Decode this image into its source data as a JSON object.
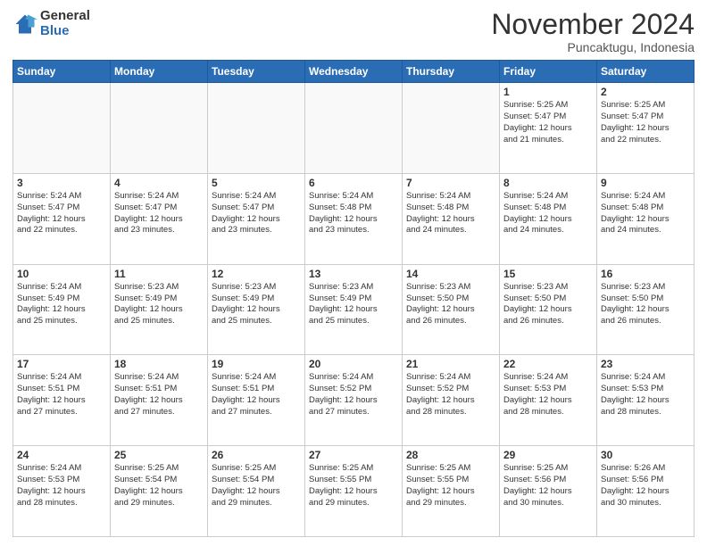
{
  "header": {
    "logo_general": "General",
    "logo_blue": "Blue",
    "month_title": "November 2024",
    "location": "Puncaktugu, Indonesia"
  },
  "weekdays": [
    "Sunday",
    "Monday",
    "Tuesday",
    "Wednesday",
    "Thursday",
    "Friday",
    "Saturday"
  ],
  "weeks": [
    [
      {
        "day": "",
        "info": ""
      },
      {
        "day": "",
        "info": ""
      },
      {
        "day": "",
        "info": ""
      },
      {
        "day": "",
        "info": ""
      },
      {
        "day": "",
        "info": ""
      },
      {
        "day": "1",
        "info": "Sunrise: 5:25 AM\nSunset: 5:47 PM\nDaylight: 12 hours\nand 21 minutes."
      },
      {
        "day": "2",
        "info": "Sunrise: 5:25 AM\nSunset: 5:47 PM\nDaylight: 12 hours\nand 22 minutes."
      }
    ],
    [
      {
        "day": "3",
        "info": "Sunrise: 5:24 AM\nSunset: 5:47 PM\nDaylight: 12 hours\nand 22 minutes."
      },
      {
        "day": "4",
        "info": "Sunrise: 5:24 AM\nSunset: 5:47 PM\nDaylight: 12 hours\nand 23 minutes."
      },
      {
        "day": "5",
        "info": "Sunrise: 5:24 AM\nSunset: 5:47 PM\nDaylight: 12 hours\nand 23 minutes."
      },
      {
        "day": "6",
        "info": "Sunrise: 5:24 AM\nSunset: 5:48 PM\nDaylight: 12 hours\nand 23 minutes."
      },
      {
        "day": "7",
        "info": "Sunrise: 5:24 AM\nSunset: 5:48 PM\nDaylight: 12 hours\nand 24 minutes."
      },
      {
        "day": "8",
        "info": "Sunrise: 5:24 AM\nSunset: 5:48 PM\nDaylight: 12 hours\nand 24 minutes."
      },
      {
        "day": "9",
        "info": "Sunrise: 5:24 AM\nSunset: 5:48 PM\nDaylight: 12 hours\nand 24 minutes."
      }
    ],
    [
      {
        "day": "10",
        "info": "Sunrise: 5:24 AM\nSunset: 5:49 PM\nDaylight: 12 hours\nand 25 minutes."
      },
      {
        "day": "11",
        "info": "Sunrise: 5:23 AM\nSunset: 5:49 PM\nDaylight: 12 hours\nand 25 minutes."
      },
      {
        "day": "12",
        "info": "Sunrise: 5:23 AM\nSunset: 5:49 PM\nDaylight: 12 hours\nand 25 minutes."
      },
      {
        "day": "13",
        "info": "Sunrise: 5:23 AM\nSunset: 5:49 PM\nDaylight: 12 hours\nand 25 minutes."
      },
      {
        "day": "14",
        "info": "Sunrise: 5:23 AM\nSunset: 5:50 PM\nDaylight: 12 hours\nand 26 minutes."
      },
      {
        "day": "15",
        "info": "Sunrise: 5:23 AM\nSunset: 5:50 PM\nDaylight: 12 hours\nand 26 minutes."
      },
      {
        "day": "16",
        "info": "Sunrise: 5:23 AM\nSunset: 5:50 PM\nDaylight: 12 hours\nand 26 minutes."
      }
    ],
    [
      {
        "day": "17",
        "info": "Sunrise: 5:24 AM\nSunset: 5:51 PM\nDaylight: 12 hours\nand 27 minutes."
      },
      {
        "day": "18",
        "info": "Sunrise: 5:24 AM\nSunset: 5:51 PM\nDaylight: 12 hours\nand 27 minutes."
      },
      {
        "day": "19",
        "info": "Sunrise: 5:24 AM\nSunset: 5:51 PM\nDaylight: 12 hours\nand 27 minutes."
      },
      {
        "day": "20",
        "info": "Sunrise: 5:24 AM\nSunset: 5:52 PM\nDaylight: 12 hours\nand 27 minutes."
      },
      {
        "day": "21",
        "info": "Sunrise: 5:24 AM\nSunset: 5:52 PM\nDaylight: 12 hours\nand 28 minutes."
      },
      {
        "day": "22",
        "info": "Sunrise: 5:24 AM\nSunset: 5:53 PM\nDaylight: 12 hours\nand 28 minutes."
      },
      {
        "day": "23",
        "info": "Sunrise: 5:24 AM\nSunset: 5:53 PM\nDaylight: 12 hours\nand 28 minutes."
      }
    ],
    [
      {
        "day": "24",
        "info": "Sunrise: 5:24 AM\nSunset: 5:53 PM\nDaylight: 12 hours\nand 28 minutes."
      },
      {
        "day": "25",
        "info": "Sunrise: 5:25 AM\nSunset: 5:54 PM\nDaylight: 12 hours\nand 29 minutes."
      },
      {
        "day": "26",
        "info": "Sunrise: 5:25 AM\nSunset: 5:54 PM\nDaylight: 12 hours\nand 29 minutes."
      },
      {
        "day": "27",
        "info": "Sunrise: 5:25 AM\nSunset: 5:55 PM\nDaylight: 12 hours\nand 29 minutes."
      },
      {
        "day": "28",
        "info": "Sunrise: 5:25 AM\nSunset: 5:55 PM\nDaylight: 12 hours\nand 29 minutes."
      },
      {
        "day": "29",
        "info": "Sunrise: 5:25 AM\nSunset: 5:56 PM\nDaylight: 12 hours\nand 30 minutes."
      },
      {
        "day": "30",
        "info": "Sunrise: 5:26 AM\nSunset: 5:56 PM\nDaylight: 12 hours\nand 30 minutes."
      }
    ]
  ]
}
